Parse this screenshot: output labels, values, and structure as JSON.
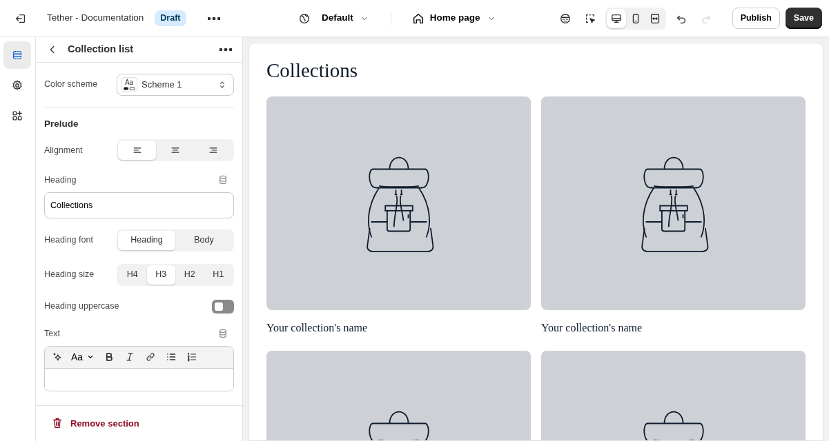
{
  "topbar": {
    "store_name": "Tether - Documentation",
    "status_badge": "Draft",
    "theme": "Default",
    "page": "Home page",
    "view_modes": [
      {
        "kind": "desktop",
        "selected": true
      },
      {
        "kind": "mobile",
        "selected": false
      },
      {
        "kind": "fullwidth",
        "selected": false
      }
    ],
    "redo_disabled": true,
    "publish": "Publish",
    "save": "Save"
  },
  "rail": [
    {
      "kind": "sections",
      "selected": true
    },
    {
      "kind": "settings",
      "selected": false
    },
    {
      "kind": "apps",
      "selected": false
    }
  ],
  "panel": {
    "title": "Collection list",
    "color_scheme": {
      "label": "Color scheme",
      "value": "Scheme 1",
      "swatch": "Aa"
    },
    "group_title": "Prelude",
    "alignment": {
      "label": "Alignment",
      "options": [
        {
          "kind": "left",
          "selected": true
        },
        {
          "kind": "center",
          "selected": false
        },
        {
          "kind": "right",
          "selected": false
        }
      ]
    },
    "heading": {
      "label": "Heading",
      "value": "Collections"
    },
    "heading_font": {
      "label": "Heading font",
      "options": [
        {
          "label": "Heading",
          "selected": true
        },
        {
          "label": "Body",
          "selected": false
        }
      ]
    },
    "heading_size": {
      "label": "Heading size",
      "options": [
        {
          "label": "H4",
          "selected": false
        },
        {
          "label": "H3",
          "selected": true
        },
        {
          "label": "H2",
          "selected": false
        },
        {
          "label": "H1",
          "selected": false
        }
      ]
    },
    "heading_uppercase": {
      "label": "Heading uppercase",
      "on": false
    },
    "text": {
      "label": "Text",
      "font_menu": "Aa"
    },
    "remove": "Remove section"
  },
  "preview": {
    "heading": "Collections",
    "collections": [
      {
        "kind": "placeholder",
        "name": "Your collection's name"
      },
      {
        "kind": "placeholder",
        "name": "Your collection's name"
      },
      {
        "kind": "placeholder"
      },
      {
        "kind": "placeholder"
      }
    ]
  }
}
